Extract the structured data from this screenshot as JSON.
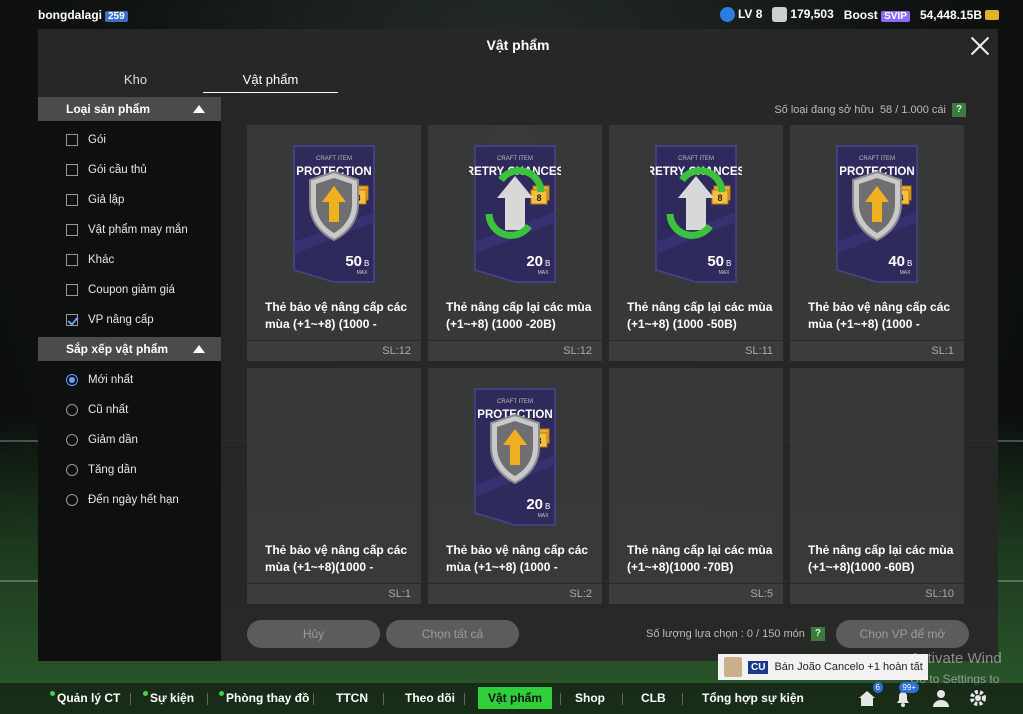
{
  "user": {
    "name": "bongdalagi",
    "badge": "259"
  },
  "top_stats": {
    "level": "LV 8",
    "points": "179,503",
    "boost_label": "Boost",
    "svip": "SVIP",
    "balance": "54,448.15B"
  },
  "modal": {
    "title": "Vật phẩm"
  },
  "tabs": [
    {
      "label": "Kho"
    },
    {
      "label": "Vật phẩm"
    }
  ],
  "filters": {
    "product_type": {
      "title": "Loại sản phẩm",
      "options": [
        {
          "label": "Gói",
          "checked": false
        },
        {
          "label": "Gói cầu thủ",
          "checked": false
        },
        {
          "label": "Giả lập",
          "checked": false
        },
        {
          "label": "Vật phẩm may mắn",
          "checked": false
        },
        {
          "label": "Khác",
          "checked": false
        },
        {
          "label": "Coupon giảm giá",
          "checked": false
        },
        {
          "label": "VP nâng cấp",
          "checked": true
        }
      ]
    },
    "sort": {
      "title": "Sắp xếp vật phẩm",
      "options": [
        {
          "label": "Mới nhất",
          "selected": true
        },
        {
          "label": "Cũ nhất",
          "selected": false
        },
        {
          "label": "Giảm dần",
          "selected": false
        },
        {
          "label": "Tăng dần",
          "selected": false
        },
        {
          "label": "Đến ngày hết hạn",
          "selected": false
        }
      ]
    }
  },
  "owned": {
    "label": "Số loại đang sở hữu",
    "value": "58 / 1.000 cái",
    "help": "?"
  },
  "items": [
    {
      "card_type": "PROTECTION",
      "card_header": "CRAFT ITEM",
      "level": "8",
      "value": "50",
      "unit": "B",
      "max": "MAX",
      "name_line1": "Thẻ bảo vệ nâng cấp các",
      "name_line2": "mùa (+1~+8) (1000 -",
      "qty": "SL:12",
      "has_art": true
    },
    {
      "card_type": "RETRY CHANCES",
      "card_header": "CRAFT ITEM",
      "level": "8",
      "value": "20",
      "unit": "B",
      "max": "MAX",
      "name_line1": "Thẻ nâng cấp lại các mùa",
      "name_line2": "(+1~+8) (1000 -20B)",
      "qty": "SL:12",
      "has_art": true
    },
    {
      "card_type": "RETRY CHANCES",
      "card_header": "CRAFT ITEM",
      "level": "8",
      "value": "50",
      "unit": "B",
      "max": "MAX",
      "name_line1": "Thẻ nâng cấp lại các mùa",
      "name_line2": "(+1~+8) (1000 -50B)",
      "qty": "SL:11",
      "has_art": true
    },
    {
      "card_type": "PROTECTION",
      "card_header": "CRAFT ITEM",
      "level": "8",
      "value": "40",
      "unit": "B",
      "max": "MAX",
      "name_line1": "Thẻ bảo vệ nâng cấp các",
      "name_line2": "mùa (+1~+8) (1000 -",
      "qty": "SL:1",
      "has_art": true
    },
    {
      "card_type": "",
      "card_header": "",
      "level": "",
      "value": "",
      "unit": "",
      "max": "",
      "name_line1": "Thẻ bảo vệ nâng cấp các",
      "name_line2": "mùa (+1~+8)(1000 -",
      "qty": "SL:1",
      "has_art": false
    },
    {
      "card_type": "PROTECTION",
      "card_header": "CRAFT ITEM",
      "level": "8",
      "value": "20",
      "unit": "B",
      "max": "MAX",
      "name_line1": "Thẻ bảo vệ nâng cấp các",
      "name_line2": "mùa (+1~+8) (1000 -",
      "qty": "SL:2",
      "has_art": true
    },
    {
      "card_type": "",
      "card_header": "",
      "level": "",
      "value": "",
      "unit": "",
      "max": "",
      "name_line1": "Thẻ nâng cấp lại các mùa",
      "name_line2": "(+1~+8)(1000 -70B)",
      "qty": "SL:5",
      "has_art": false
    },
    {
      "card_type": "",
      "card_header": "",
      "level": "",
      "value": "",
      "unit": "",
      "max": "",
      "name_line1": "Thẻ nâng cấp lại các mùa",
      "name_line2": "(+1~+8)(1000 -60B)",
      "qty": "SL:10",
      "has_art": false
    }
  ],
  "footer": {
    "cancel": "Hủy",
    "select_all": "Chọn tất cả",
    "selection_label": "Số lượng lựa chọn : 0 / 150 món",
    "help": "?",
    "choose_upgrade": "Chọn VP để mở"
  },
  "bottom_nav": [
    {
      "label": "Quản lý CT",
      "dot": true
    },
    {
      "label": "Sự kiện",
      "dot": true
    },
    {
      "label": "Phòng thay đồ",
      "dot": true
    },
    {
      "label": "TTCN",
      "dot": false
    },
    {
      "label": "Theo dõi",
      "dot": false
    },
    {
      "label": "Vật phẩm",
      "dot": false,
      "active": true
    },
    {
      "label": "Shop",
      "dot": false
    },
    {
      "label": "CLB",
      "dot": false
    },
    {
      "label": "Tổng hợp sự kiện",
      "dot": false
    }
  ],
  "nav_badges": {
    "home": "6",
    "notifications": "99+"
  },
  "toast": {
    "tag": "CU",
    "text": "Bán João Cancelo +1 hoàn tất"
  },
  "watermark": {
    "line1": "Activate Wind",
    "line2": "Go to Settings to"
  },
  "colors": {
    "accent_green": "#2fcf3a",
    "card_purple": "#2e2a5c",
    "check_blue": "#6aa0ff"
  },
  "icons": {
    "level": "level-face-icon",
    "points": "trophy-icon",
    "home": "home-icon",
    "bell": "bell-icon",
    "user": "user-icon",
    "settings": "gear-icon"
  }
}
